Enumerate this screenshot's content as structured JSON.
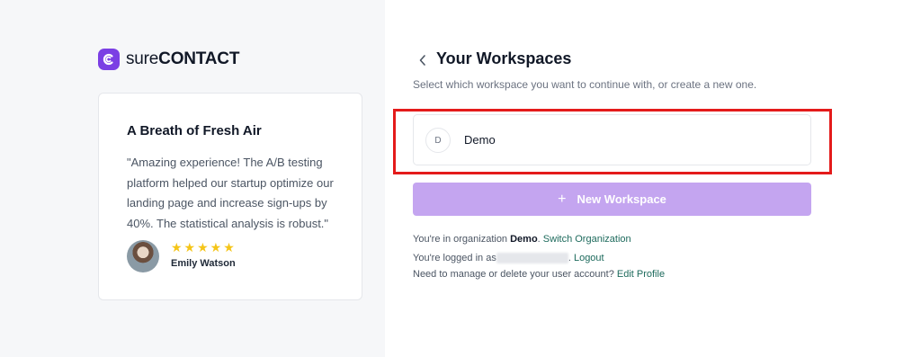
{
  "brand": {
    "logo_light": "sure",
    "logo_bold": "CONTACT",
    "accent_color": "#7b3fe4",
    "icon": "surecontact-logo-icon"
  },
  "testimonial": {
    "title": "A Breath of Fresh Air",
    "quote": "\"Amazing experience! The A/B testing platform helped our startup optimize our landing page and increase sign-ups by 40%. The statistical analysis is robust.\"",
    "rating": 5,
    "stars": "★★★★★",
    "reviewer_name": "Emily Watson"
  },
  "header": {
    "back_icon": "chevron-left-icon",
    "title": "Your Workspaces",
    "subtitle": "Select which workspace you want to continue with, or create a new one."
  },
  "workspaces": [
    {
      "initial": "D",
      "name": "Demo"
    }
  ],
  "new_workspace": {
    "plus": "+",
    "label": "New Workspace",
    "color": "#c4a5f0"
  },
  "info": {
    "org_prefix": "You're in organization ",
    "org_name": "Demo",
    "org_suffix": ". ",
    "switch_org_link": "Switch Organization",
    "logged_prefix": "You're logged in as",
    "logged_suffix": ". ",
    "logout_link": "Logout",
    "manage_prefix": "Need to manage or delete your user account? ",
    "edit_profile_link": "Edit Profile",
    "link_color": "#1d6a5c"
  },
  "highlight_color": "#e41b1b"
}
